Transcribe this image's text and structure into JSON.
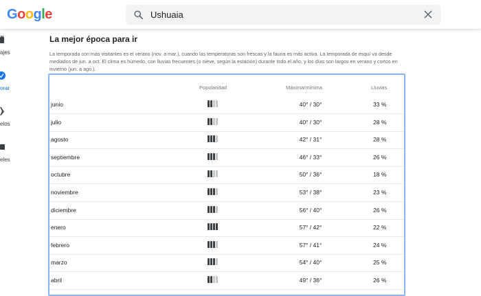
{
  "header": {
    "logo": "Google",
    "search_query": "Ushuaia"
  },
  "sidebar": [
    {
      "label": "ajes",
      "icon": "luggage-icon",
      "active": false
    },
    {
      "label": "orar",
      "icon": "explore-icon",
      "active": true
    },
    {
      "label": "elos",
      "icon": "flight-icon",
      "active": false
    },
    {
      "label": "eles",
      "icon": "hotel-icon",
      "active": false
    }
  ],
  "section": {
    "title": "La mejor época para ir",
    "description": "La temporada con más visitantes es el verano (nov. a mar.), cuando las temperaturas son frescas y la fauna es más activa. La temporada de esquí va desde mediados de jun. a oct. El clima es húmedo, con lluvias frecuentes (o nieve, según la estación) durante todo el año, y los días son largos en verano y cortos en invierno (jun. a ago.)."
  },
  "table": {
    "headers": {
      "popularity": "Popularidad",
      "temp": "Máxima/mínima",
      "rain": "Lluvias"
    },
    "rows": [
      {
        "month": "junio",
        "popularity": 2,
        "temp": "40° / 30°",
        "rain": "33 %"
      },
      {
        "month": "julio",
        "popularity": 2,
        "temp": "40° / 30°",
        "rain": "28 %"
      },
      {
        "month": "agosto",
        "popularity": 3,
        "temp": "42° / 31°",
        "rain": "28 %"
      },
      {
        "month": "septiembre",
        "popularity": 3,
        "temp": "46° / 33°",
        "rain": "26 %"
      },
      {
        "month": "octubre",
        "popularity": 2,
        "temp": "50° / 36°",
        "rain": "18 %"
      },
      {
        "month": "noviembre",
        "popularity": 3,
        "temp": "53° / 38°",
        "rain": "23 %"
      },
      {
        "month": "diciembre",
        "popularity": 3,
        "temp": "56° / 40°",
        "rain": "26 %"
      },
      {
        "month": "enero",
        "popularity": 4,
        "temp": "57° / 42°",
        "rain": "22 %"
      },
      {
        "month": "febrero",
        "popularity": 3,
        "temp": "57° / 41°",
        "rain": "24 %"
      },
      {
        "month": "marzo",
        "popularity": 3,
        "temp": "54° / 40°",
        "rain": "25 %"
      },
      {
        "month": "abril",
        "popularity": 2,
        "temp": "49° / 36°",
        "rain": "26 %"
      }
    ],
    "popularity_max": 4
  },
  "colors": {
    "accent": "#1a73e8",
    "figure_on": "#3c4043",
    "figure_off": "#c4c7c5",
    "table_border": "#8ab4f8"
  }
}
